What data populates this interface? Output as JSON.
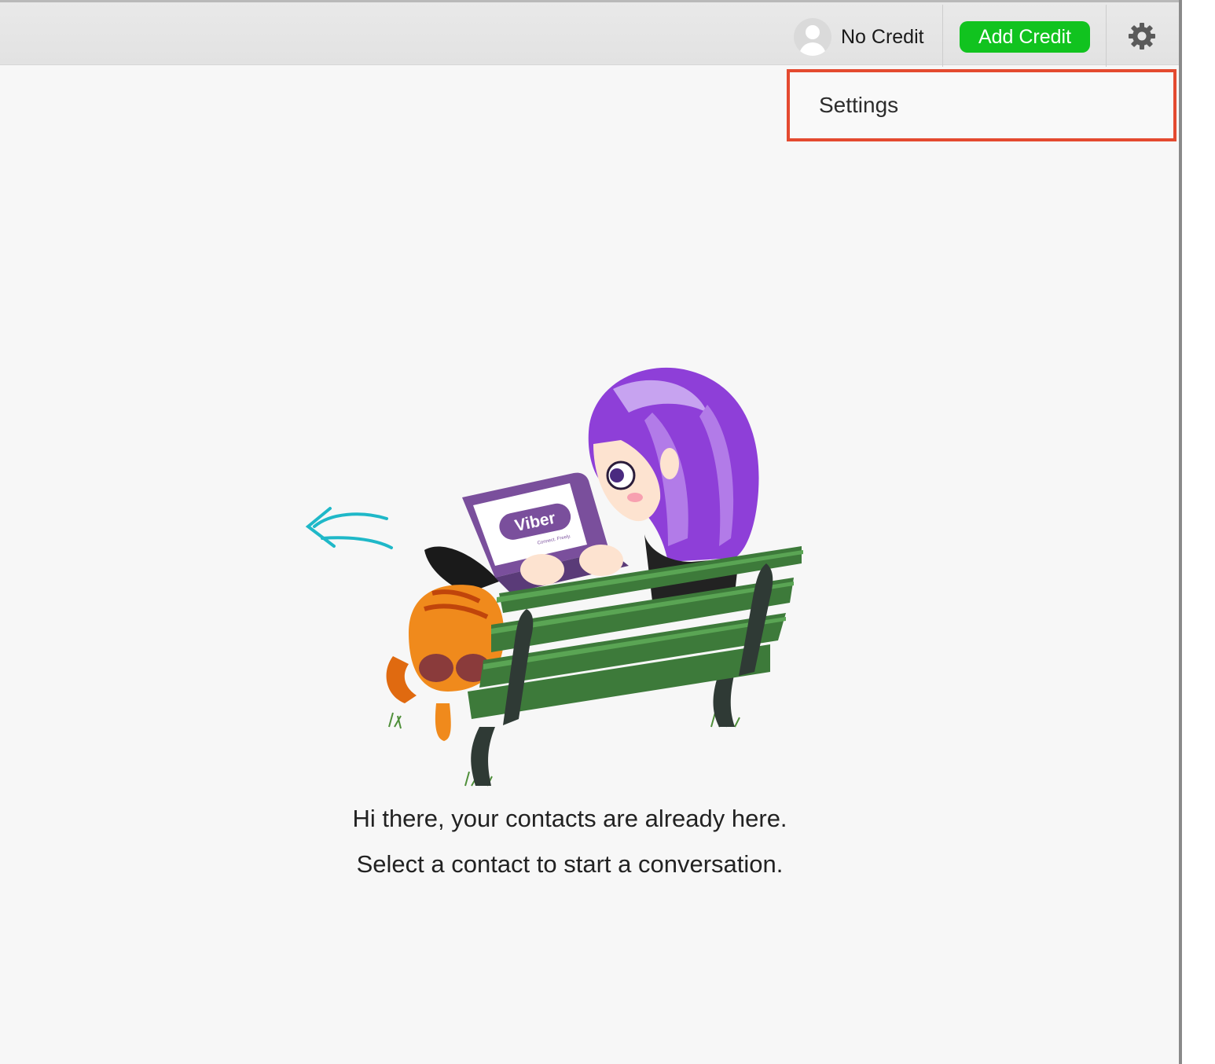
{
  "topbar": {
    "credit_status": "No Credit",
    "add_credit_label": "Add Credit",
    "accent_color": "#11c31f"
  },
  "dropdown": {
    "items": [
      {
        "label": "Settings"
      }
    ],
    "highlight_color": "#e44a30"
  },
  "illustration": {
    "laptop_logo": "Viber",
    "laptop_tagline": "Connect. Freely."
  },
  "empty_state": {
    "line1": "Hi there, your contacts are already here.",
    "line2": "Select a contact to start a conversation."
  },
  "icons": {
    "avatar": "user-avatar-icon",
    "settings": "gear-icon",
    "hint_arrow": "arrow-left-icon"
  }
}
